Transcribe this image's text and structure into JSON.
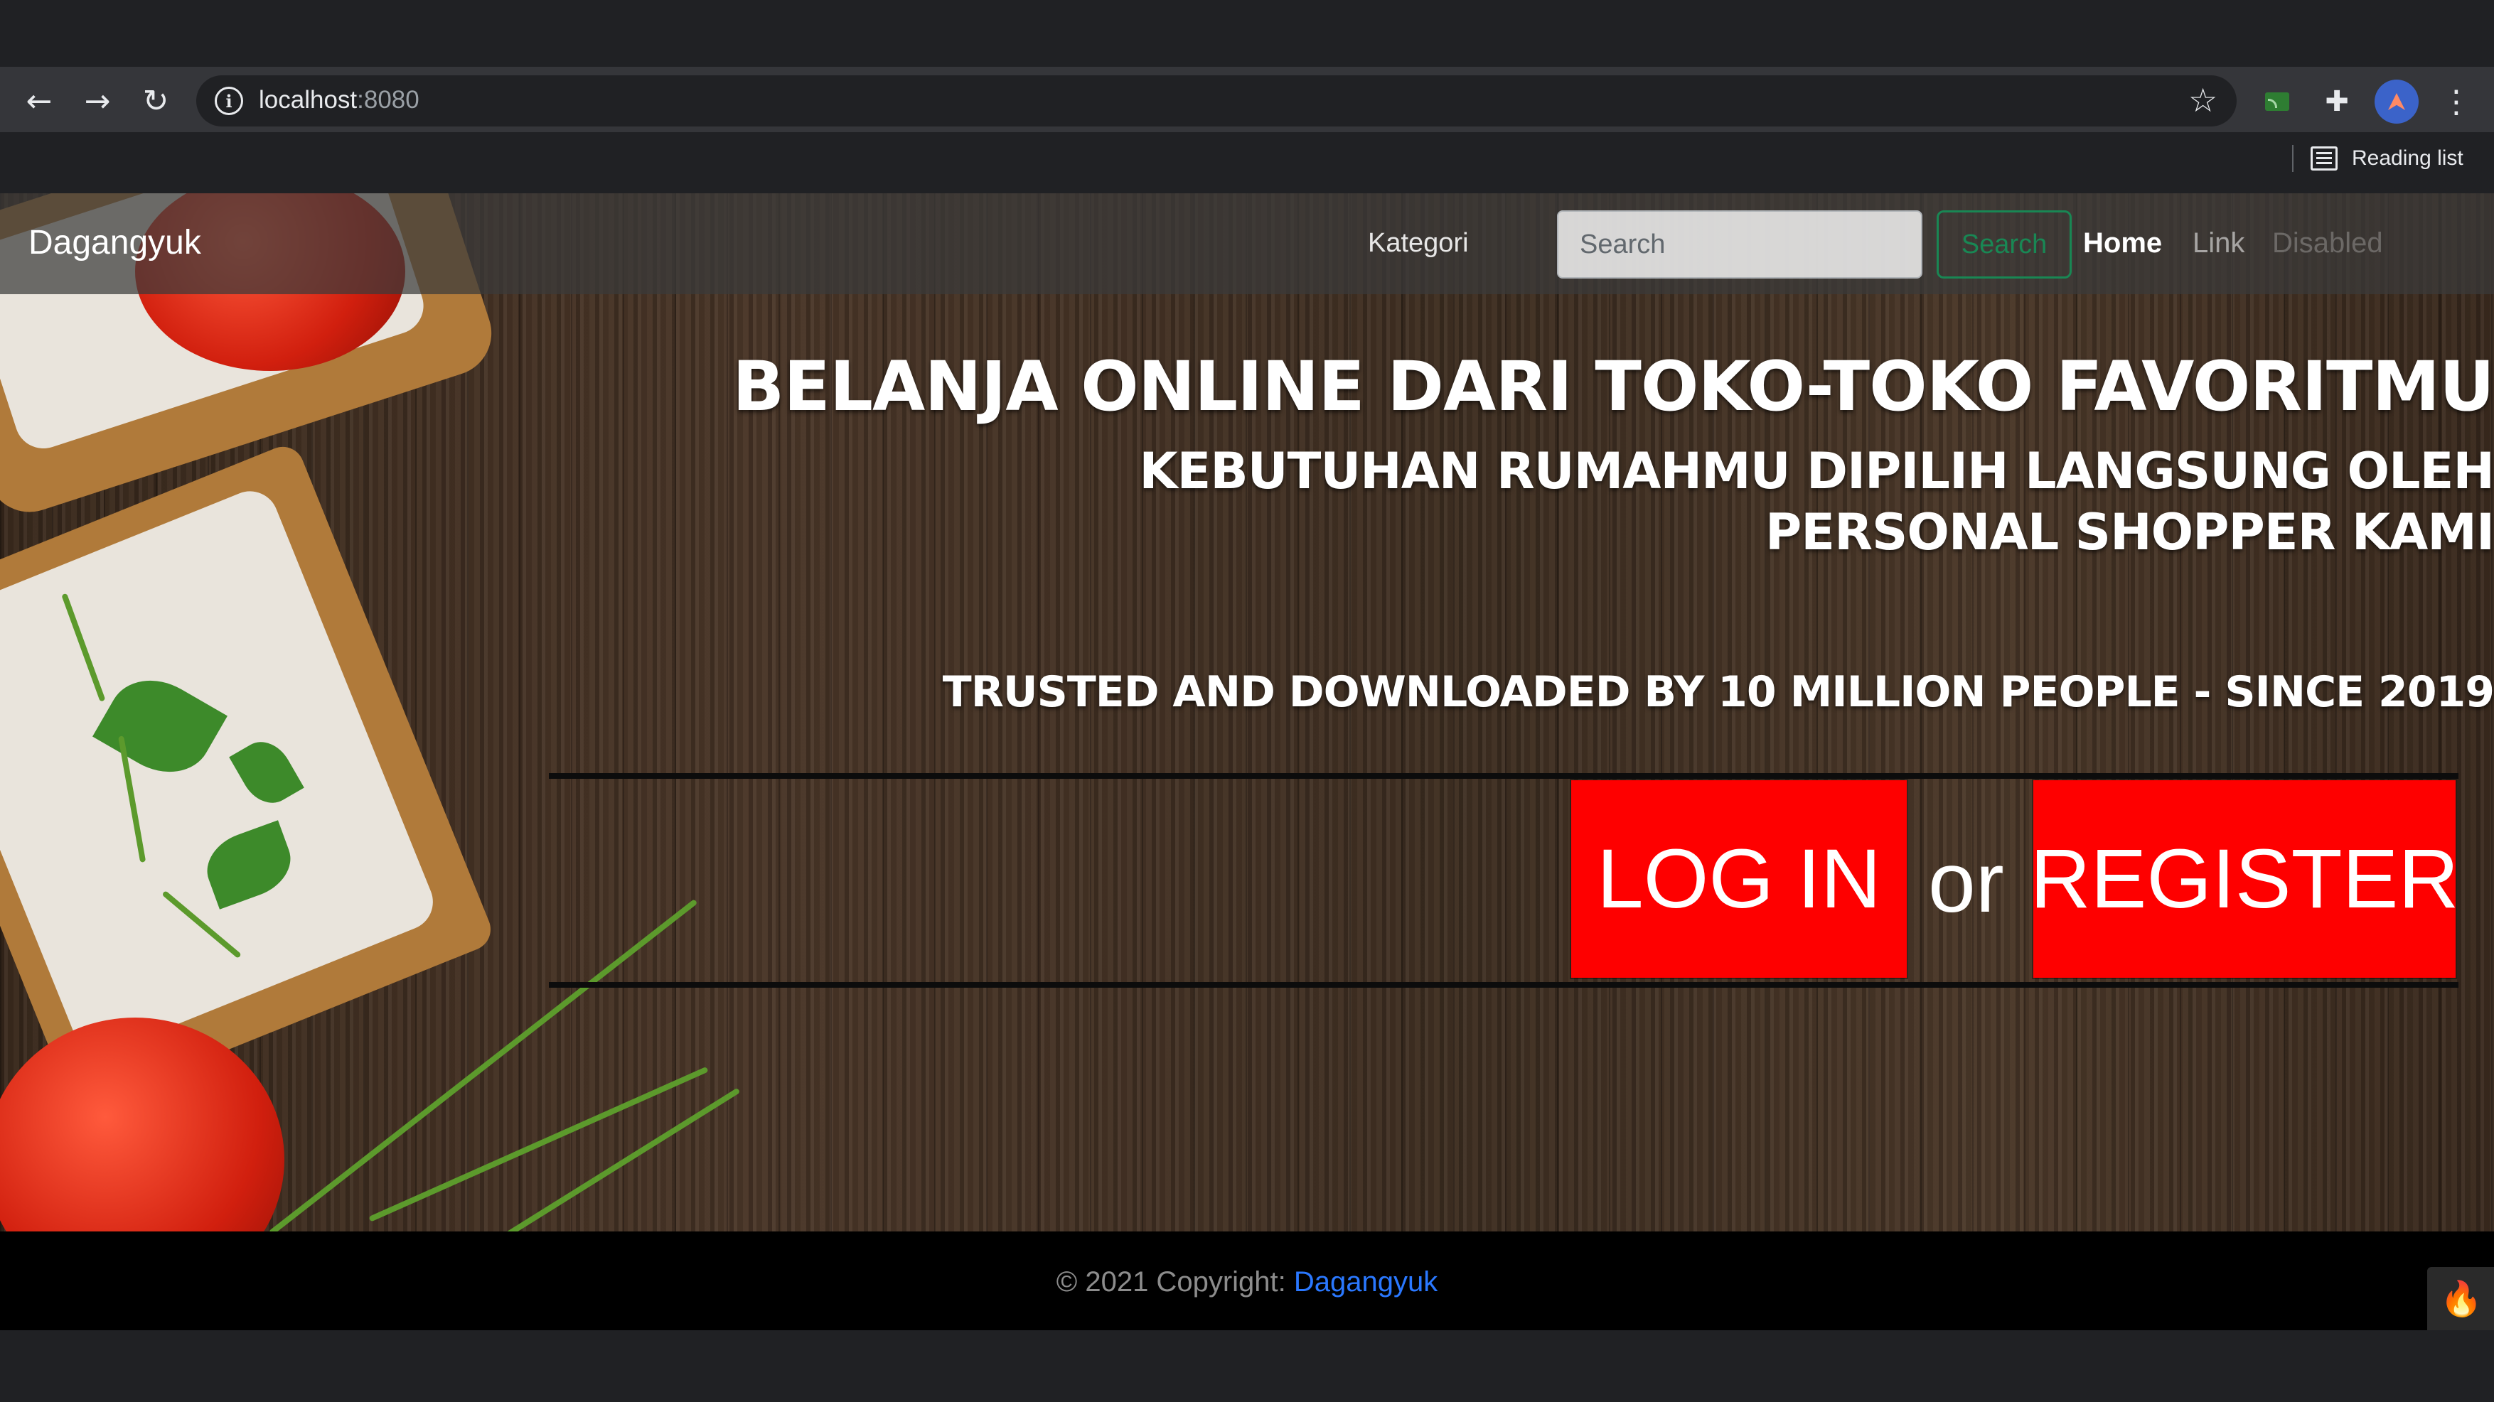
{
  "browser": {
    "url_host": "localhost",
    "url_port": ":8080",
    "reading_list_label": "Reading list",
    "icons": {
      "back": "back-arrow-icon",
      "forward": "forward-arrow-icon",
      "reload": "reload-icon",
      "site_info": "info-icon",
      "bookmark": "star-icon",
      "cast": "cast-icon",
      "extensions": "puzzle-icon",
      "menu": "kebab-menu-icon"
    }
  },
  "navbar": {
    "brand": "Dagangyuk",
    "kategori": "Kategori",
    "search_placeholder": "Search",
    "search_button": "Search",
    "links": {
      "home": "Home",
      "link": "Link",
      "disabled": "Disabled"
    }
  },
  "hero": {
    "headline": "BELANJA ONLINE DARI TOKO-TOKO FAVORITMU",
    "subline_1": "KEBUTUHAN RUMAHMU DIPILIH LANGSUNG OLEH",
    "subline_2": "PERSONAL SHOPPER KAMI",
    "trusted": "TRUSTED AND DOWNLOADED BY 10 MILLION PEOPLE - SINCE 2019",
    "login_label": "LOG IN",
    "or_label": "or",
    "register_label": "REGISTER"
  },
  "footer": {
    "copyright_prefix": "© 2021 Copyright: ",
    "copyright_link": "Dagangyuk"
  },
  "colors": {
    "cta_red": "#fe0000",
    "search_green": "#198754",
    "footer_link": "#2a78ff",
    "footer_bg": "#000000"
  }
}
